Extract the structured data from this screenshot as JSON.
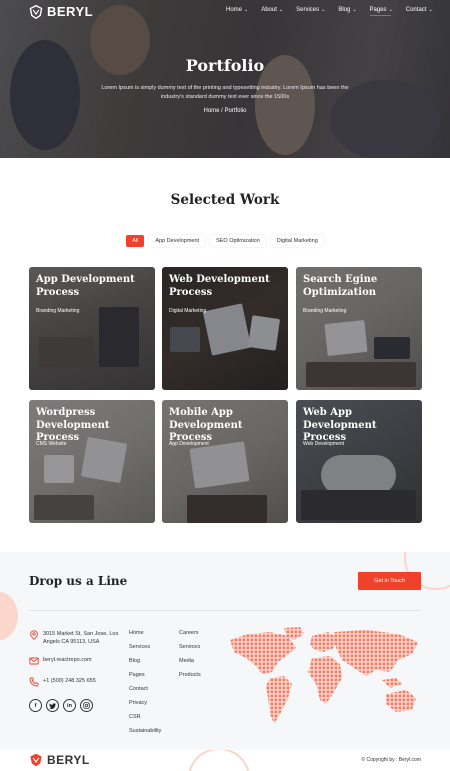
{
  "brand": {
    "name": "BERYL",
    "accent_color": "#f0412a"
  },
  "nav": {
    "items": [
      {
        "label": "Home",
        "has_dropdown": true,
        "active": false
      },
      {
        "label": "About",
        "has_dropdown": true,
        "active": false
      },
      {
        "label": "Services",
        "has_dropdown": true,
        "active": false
      },
      {
        "label": "Blog",
        "has_dropdown": true,
        "active": false
      },
      {
        "label": "Pages",
        "has_dropdown": true,
        "active": true
      },
      {
        "label": "Contact",
        "has_dropdown": true,
        "active": false
      }
    ]
  },
  "hero": {
    "title": "Portfolio",
    "subtitle": "Lorem Ipsum is simply dummy text of the printing and typesetting industry. Lorem Ipsum has been the industry's standard dummy text ever since the 1500s",
    "breadcrumb": "Home / Portfolio"
  },
  "work": {
    "title": "Selected Work",
    "filters": [
      "All",
      "App Development",
      "SEO Optimization",
      "Digital Marketing"
    ],
    "active_filter": "All",
    "cards": [
      {
        "title": "App Development Process",
        "category": "Branding Marketing"
      },
      {
        "title": "Web Development Process",
        "category": "Digital Marketing"
      },
      {
        "title": "Search Egine Optimization",
        "category": "Branding Marketing"
      },
      {
        "title": "Wordpress Development Process",
        "category": "CMS Website"
      },
      {
        "title": "Mobile App Development Process",
        "category": "App Development"
      },
      {
        "title": "Web App Development Process",
        "category": "Web Development"
      }
    ]
  },
  "contact": {
    "title": "Drop us a Line",
    "cta": "Get in Touch",
    "address": "3015 Market St, San Jose, Los Angels CA 95113, USA",
    "email": "beryl.reactrepo.com",
    "phone": "+1 (500) 248 325 655",
    "socials": [
      "facebook-icon",
      "twitter-icon",
      "linkedin-icon",
      "instagram-icon"
    ],
    "links_col1": [
      "Home",
      "Services",
      "Blog",
      "Pages",
      "Contact",
      "Privacy",
      "CSR",
      "Sustainability"
    ],
    "links_col2": [
      "Careers",
      "Services",
      "Media",
      "Products"
    ]
  },
  "footer": {
    "brand": "BERYL",
    "copyright": "© Copyright by : Beryl.com"
  }
}
